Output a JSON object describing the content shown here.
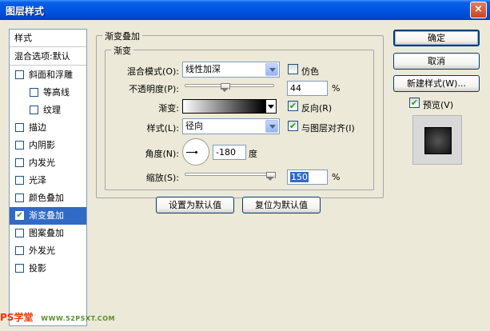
{
  "window": {
    "title": "图层样式",
    "close_glyph": "×"
  },
  "styles_panel": {
    "header": "样式",
    "blend_options": "混合选项:默认",
    "items": [
      {
        "label": "斜面和浮雕",
        "checked": false
      },
      {
        "label": "等高线",
        "checked": false
      },
      {
        "label": "纹理",
        "checked": false
      },
      {
        "label": "描边",
        "checked": false
      },
      {
        "label": "内阴影",
        "checked": false
      },
      {
        "label": "内发光",
        "checked": false
      },
      {
        "label": "光泽",
        "checked": false
      },
      {
        "label": "颜色叠加",
        "checked": false
      },
      {
        "label": "渐变叠加",
        "checked": true
      },
      {
        "label": "图案叠加",
        "checked": false
      },
      {
        "label": "外发光",
        "checked": false
      },
      {
        "label": "投影",
        "checked": false
      }
    ],
    "check_glyph": "✔"
  },
  "gradient_overlay": {
    "group_title": "渐变叠加",
    "sub_group_title": "渐变",
    "blend_mode_label": "混合模式(O):",
    "blend_mode_value": "线性加深",
    "dither_label": "仿色",
    "dither_checked": false,
    "opacity_label": "不透明度(P):",
    "opacity_value": "44",
    "opacity_unit": "%",
    "opacity_fraction": 0.44,
    "gradient_label": "渐变:",
    "reverse_label": "反向(R)",
    "reverse_checked": true,
    "style_label": "样式(L):",
    "style_value": "径向",
    "align_label": "与图层对齐(I)",
    "align_checked": true,
    "angle_label": "角度(N):",
    "angle_value": "-180",
    "angle_unit": "度",
    "scale_label": "缩放(S):",
    "scale_value": "150",
    "scale_unit": "%",
    "scale_fraction": 1.0,
    "make_default_button": "设置为默认值",
    "reset_default_button": "复位为默认值"
  },
  "actions": {
    "ok": "确定",
    "cancel": "取消",
    "new_style": "新建样式(W)...",
    "preview_label": "预览(V)",
    "preview_checked": true
  },
  "watermark": {
    "text_a": "PS学堂",
    "text_b": "WWW.52PSXT.COM"
  }
}
